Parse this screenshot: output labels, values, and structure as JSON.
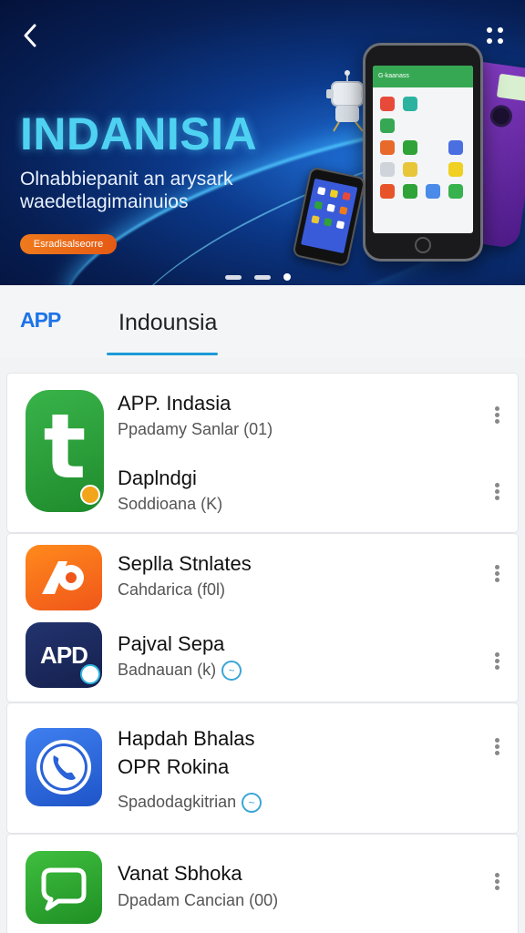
{
  "banner": {
    "title": "INDANISIA",
    "subtitle_line1": "Olnabbiepanit an arysark",
    "subtitle_line2": "waedetlagimainuios",
    "cta_label": "Esradisalseorre",
    "phone_topbar": "G-kaanass"
  },
  "tabs": {
    "app_label": "APP",
    "main_label": "Indounsia"
  },
  "apps": [
    {
      "title": "APP. Indasia",
      "subtitle": "Ppadamy Sanlar (01)"
    },
    {
      "title": "Daplndgi",
      "subtitle": "Soddioana (K)"
    },
    {
      "title": "Seplla Stnlates",
      "subtitle": "Cahdarica (f0l)"
    },
    {
      "title": "Pajval Sepa",
      "subtitle": "Badnauan (k)"
    },
    {
      "title": "Hapdah Bhalas",
      "title2": "OPR Rokina",
      "subtitle": "Spadodagkitrian"
    },
    {
      "title": "Vanat Sbhoka",
      "subtitle": "Dpadam Cancian (00)"
    }
  ],
  "icon_letters": {
    "green_t": "t",
    "apd": "APD"
  },
  "colors": {
    "accent": "#1d73e8",
    "tab_underline": "#1c9ad6",
    "green": "#2fa337",
    "orange": "#f07a1c",
    "navy": "#1c2f7a"
  }
}
